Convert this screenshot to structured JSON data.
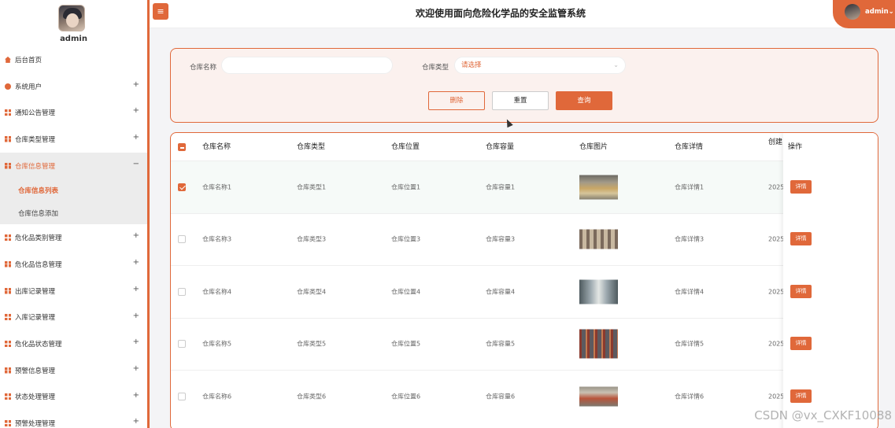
{
  "sidebar": {
    "username": "admin",
    "items": [
      {
        "label": "后台首页",
        "icon": "home-icon",
        "expand": ""
      },
      {
        "label": "系统用户",
        "icon": "user-icon",
        "expand": "+"
      },
      {
        "label": "通知公告管理",
        "icon": "grid-icon",
        "expand": "+"
      },
      {
        "label": "仓库类型管理",
        "icon": "grid-icon",
        "expand": "+"
      },
      {
        "label": "仓库信息管理",
        "icon": "grid-icon",
        "expand": "−"
      },
      {
        "label": "危化品类别管理",
        "icon": "grid-icon",
        "expand": "+"
      },
      {
        "label": "危化品信息管理",
        "icon": "grid-icon",
        "expand": "+"
      },
      {
        "label": "出库记录管理",
        "icon": "grid-icon",
        "expand": "+"
      },
      {
        "label": "入库记录管理",
        "icon": "grid-icon",
        "expand": "+"
      },
      {
        "label": "危化品状态管理",
        "icon": "grid-icon",
        "expand": "+"
      },
      {
        "label": "预警信息管理",
        "icon": "grid-icon",
        "expand": "+"
      },
      {
        "label": "状态处理管理",
        "icon": "grid-icon",
        "expand": "+"
      },
      {
        "label": "预警处理管理",
        "icon": "grid-icon",
        "expand": "+"
      }
    ],
    "sub_items": [
      "仓库信息列表",
      "仓库信息添加"
    ]
  },
  "header": {
    "menu_icon": "hamburger-icon",
    "title": "欢迎使用面向危险化学品的安全监管系统",
    "user": "admin"
  },
  "search": {
    "name_label": "仓库名称",
    "name_value": "",
    "type_label": "仓库类型",
    "type_value": "请选择",
    "delete_label": "删除",
    "reset_label": "重置",
    "query_label": "查询"
  },
  "table": {
    "columns": [
      "仓库名称",
      "仓库类型",
      "仓库位置",
      "仓库容量",
      "仓库图片",
      "仓库详情",
      "创建",
      "操作"
    ],
    "rows": [
      {
        "name": "仓库名称1",
        "type": "仓库类型1",
        "location": "仓库位置1",
        "capacity": "仓库容量1",
        "detail": "仓库详情1",
        "created": "2025",
        "action": "详情",
        "selected": true
      },
      {
        "name": "仓库名称3",
        "type": "仓库类型3",
        "location": "仓库位置3",
        "capacity": "仓库容量3",
        "detail": "仓库详情3",
        "created": "2025",
        "action": "详情",
        "selected": false
      },
      {
        "name": "仓库名称4",
        "type": "仓库类型4",
        "location": "仓库位置4",
        "capacity": "仓库容量4",
        "detail": "仓库详情4",
        "created": "2025",
        "action": "详情",
        "selected": false
      },
      {
        "name": "仓库名称5",
        "type": "仓库类型5",
        "location": "仓库位置5",
        "capacity": "仓库容量5",
        "detail": "仓库详情5",
        "created": "2025",
        "action": "详情",
        "selected": false
      },
      {
        "name": "仓库名称6",
        "type": "仓库类型6",
        "location": "仓库位置6",
        "capacity": "仓库容量6",
        "detail": "仓库详情6",
        "created": "2025",
        "action": "详情",
        "selected": false
      }
    ]
  },
  "watermark": "CSDN @vx_CXKF10088",
  "colors": {
    "accent": "#e0683a",
    "panel": "#fbf1ee"
  }
}
